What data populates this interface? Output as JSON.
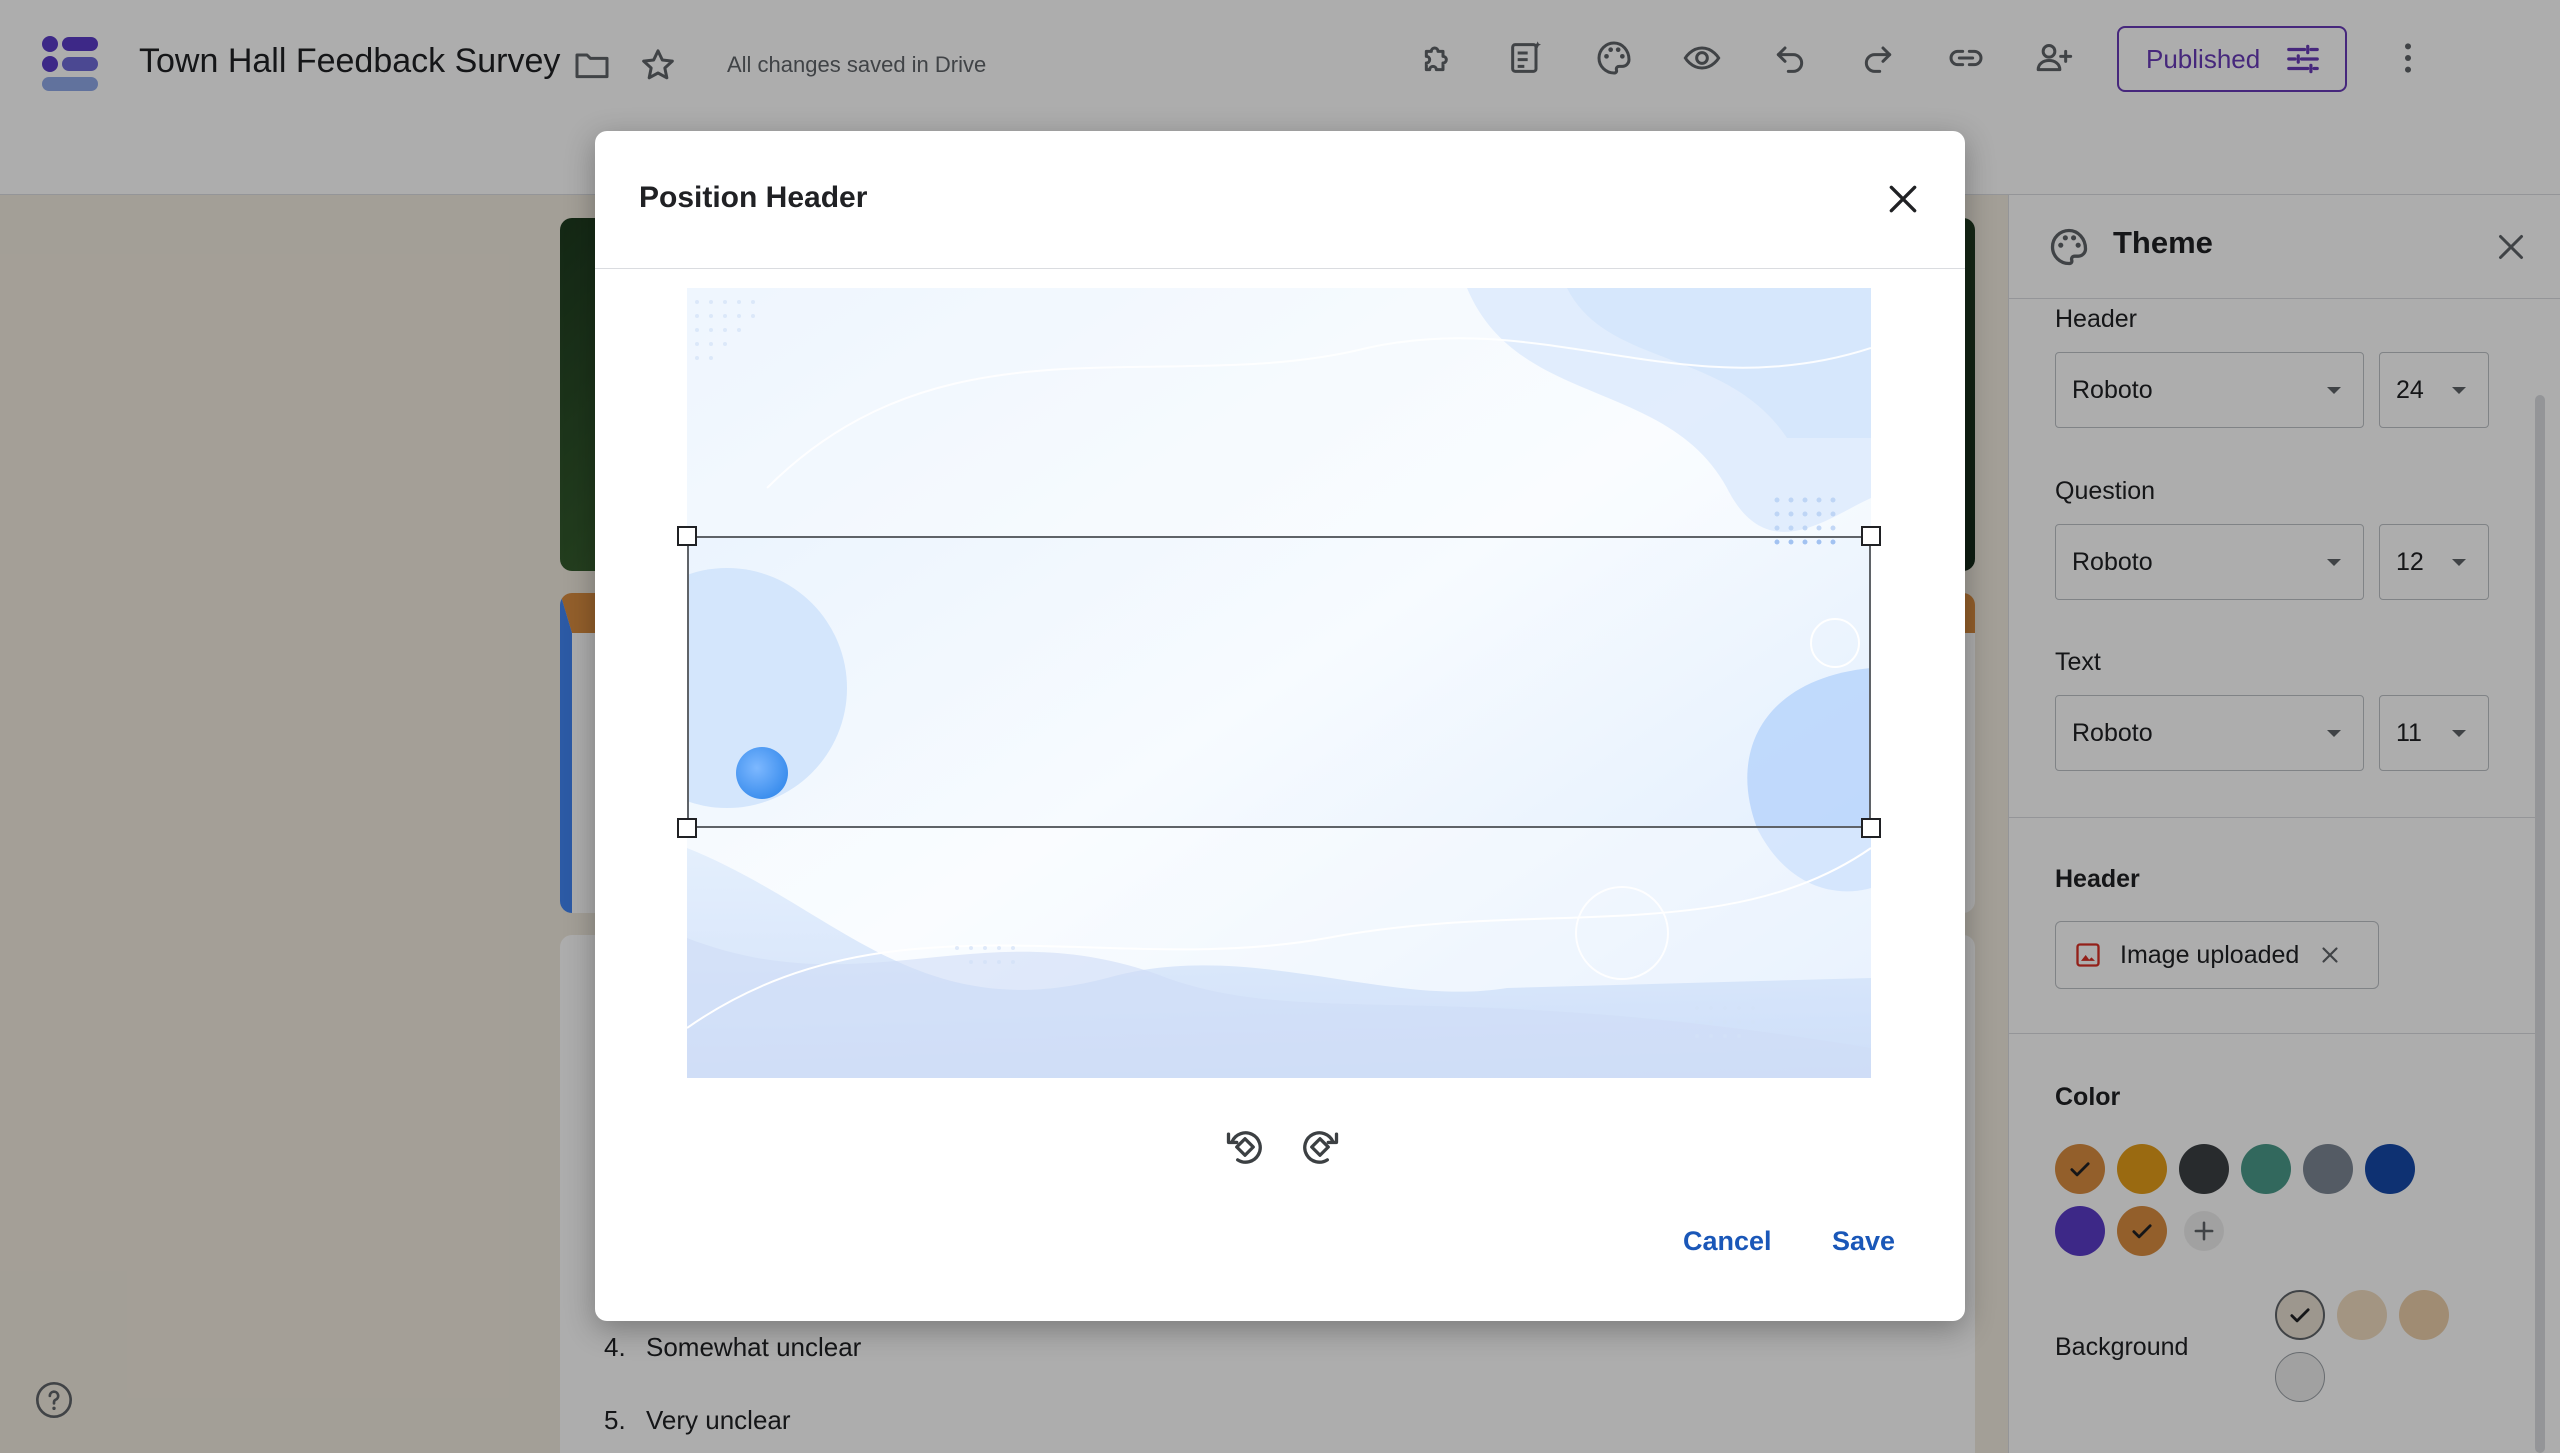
{
  "topbar": {
    "title": "Town Hall Feedback Survey",
    "saved_status": "All changes saved in Drive",
    "published_label": "Published",
    "icons": [
      "folder-icon",
      "star-icon",
      "addon-icon",
      "quiz-icon",
      "palette-icon",
      "eye-icon",
      "undo-icon",
      "redo-icon",
      "link-icon",
      "add-person-icon",
      "more-vert-icon"
    ]
  },
  "form": {
    "options": [
      {
        "num": "4.",
        "label": "Somewhat unclear"
      },
      {
        "num": "5.",
        "label": "Very unclear"
      }
    ]
  },
  "theme": {
    "title": "Theme",
    "text_style": {
      "header": {
        "label": "Header",
        "font": "Roboto",
        "size": "24"
      },
      "question": {
        "label": "Question",
        "font": "Roboto",
        "size": "12"
      },
      "text": {
        "label": "Text",
        "font": "Roboto",
        "size": "11"
      }
    },
    "header_section": {
      "label": "Header",
      "chip_label": "Image uploaded"
    },
    "color": {
      "label": "Color",
      "swatches": [
        "#d98c40",
        "#e39c1a",
        "#3c4043",
        "#4a9a8a",
        "#7c8794",
        "#1549a8",
        "#5b3bc7",
        "#d98c40"
      ],
      "selected_index": 7
    },
    "background": {
      "label": "Background",
      "swatches": [
        "#e8dfd2",
        "#f0dcc0",
        "#eccfaa",
        "#eeeeee"
      ],
      "selected_index": 0
    }
  },
  "dialog": {
    "title": "Position Header",
    "cancel_label": "Cancel",
    "save_label": "Save"
  },
  "colors": {
    "accent": "#673ab7",
    "link_blue": "#1a57b8"
  }
}
